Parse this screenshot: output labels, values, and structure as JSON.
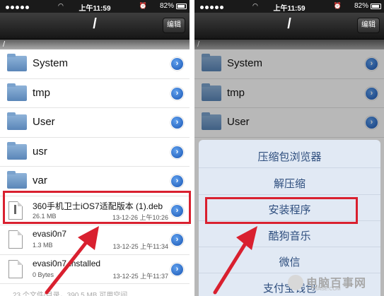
{
  "status_bar": {
    "time": "上午11:59",
    "battery": "82%"
  },
  "nav": {
    "title": "/",
    "edit_label": "编辑"
  },
  "path": "/",
  "files": [
    {
      "name": "System",
      "type": "folder"
    },
    {
      "name": "tmp",
      "type": "folder"
    },
    {
      "name": "User",
      "type": "folder"
    },
    {
      "name": "usr",
      "type": "folder"
    },
    {
      "name": "var",
      "type": "folder"
    },
    {
      "name": "360手机卫士iOS7适配版本 (1).deb",
      "type": "deb",
      "size": "26.1 MB",
      "date": "13-12-26 上午10:26"
    },
    {
      "name": "evasi0n7",
      "type": "file",
      "size": "1.3 MB",
      "date": "13-12-25 上午11:34"
    },
    {
      "name": "evasi0n7-installed",
      "type": "file",
      "size": "0 Bytes",
      "date": "13-12-25 上午11:37"
    }
  ],
  "footer": "23 个文件/目录，390.5 MB 可用空间",
  "action_sheet": {
    "items": [
      "压缩包浏览器",
      "解压缩",
      "安装程序",
      "酷狗音乐",
      "微信",
      "支付宝钱包"
    ]
  },
  "watermark": {
    "text": "电脑百事网",
    "sub": "PCBASE.COM"
  },
  "colors": {
    "highlight": "#d9202f",
    "sheet_text": "#2e4e7e",
    "detail_button": "#1a56b3"
  }
}
